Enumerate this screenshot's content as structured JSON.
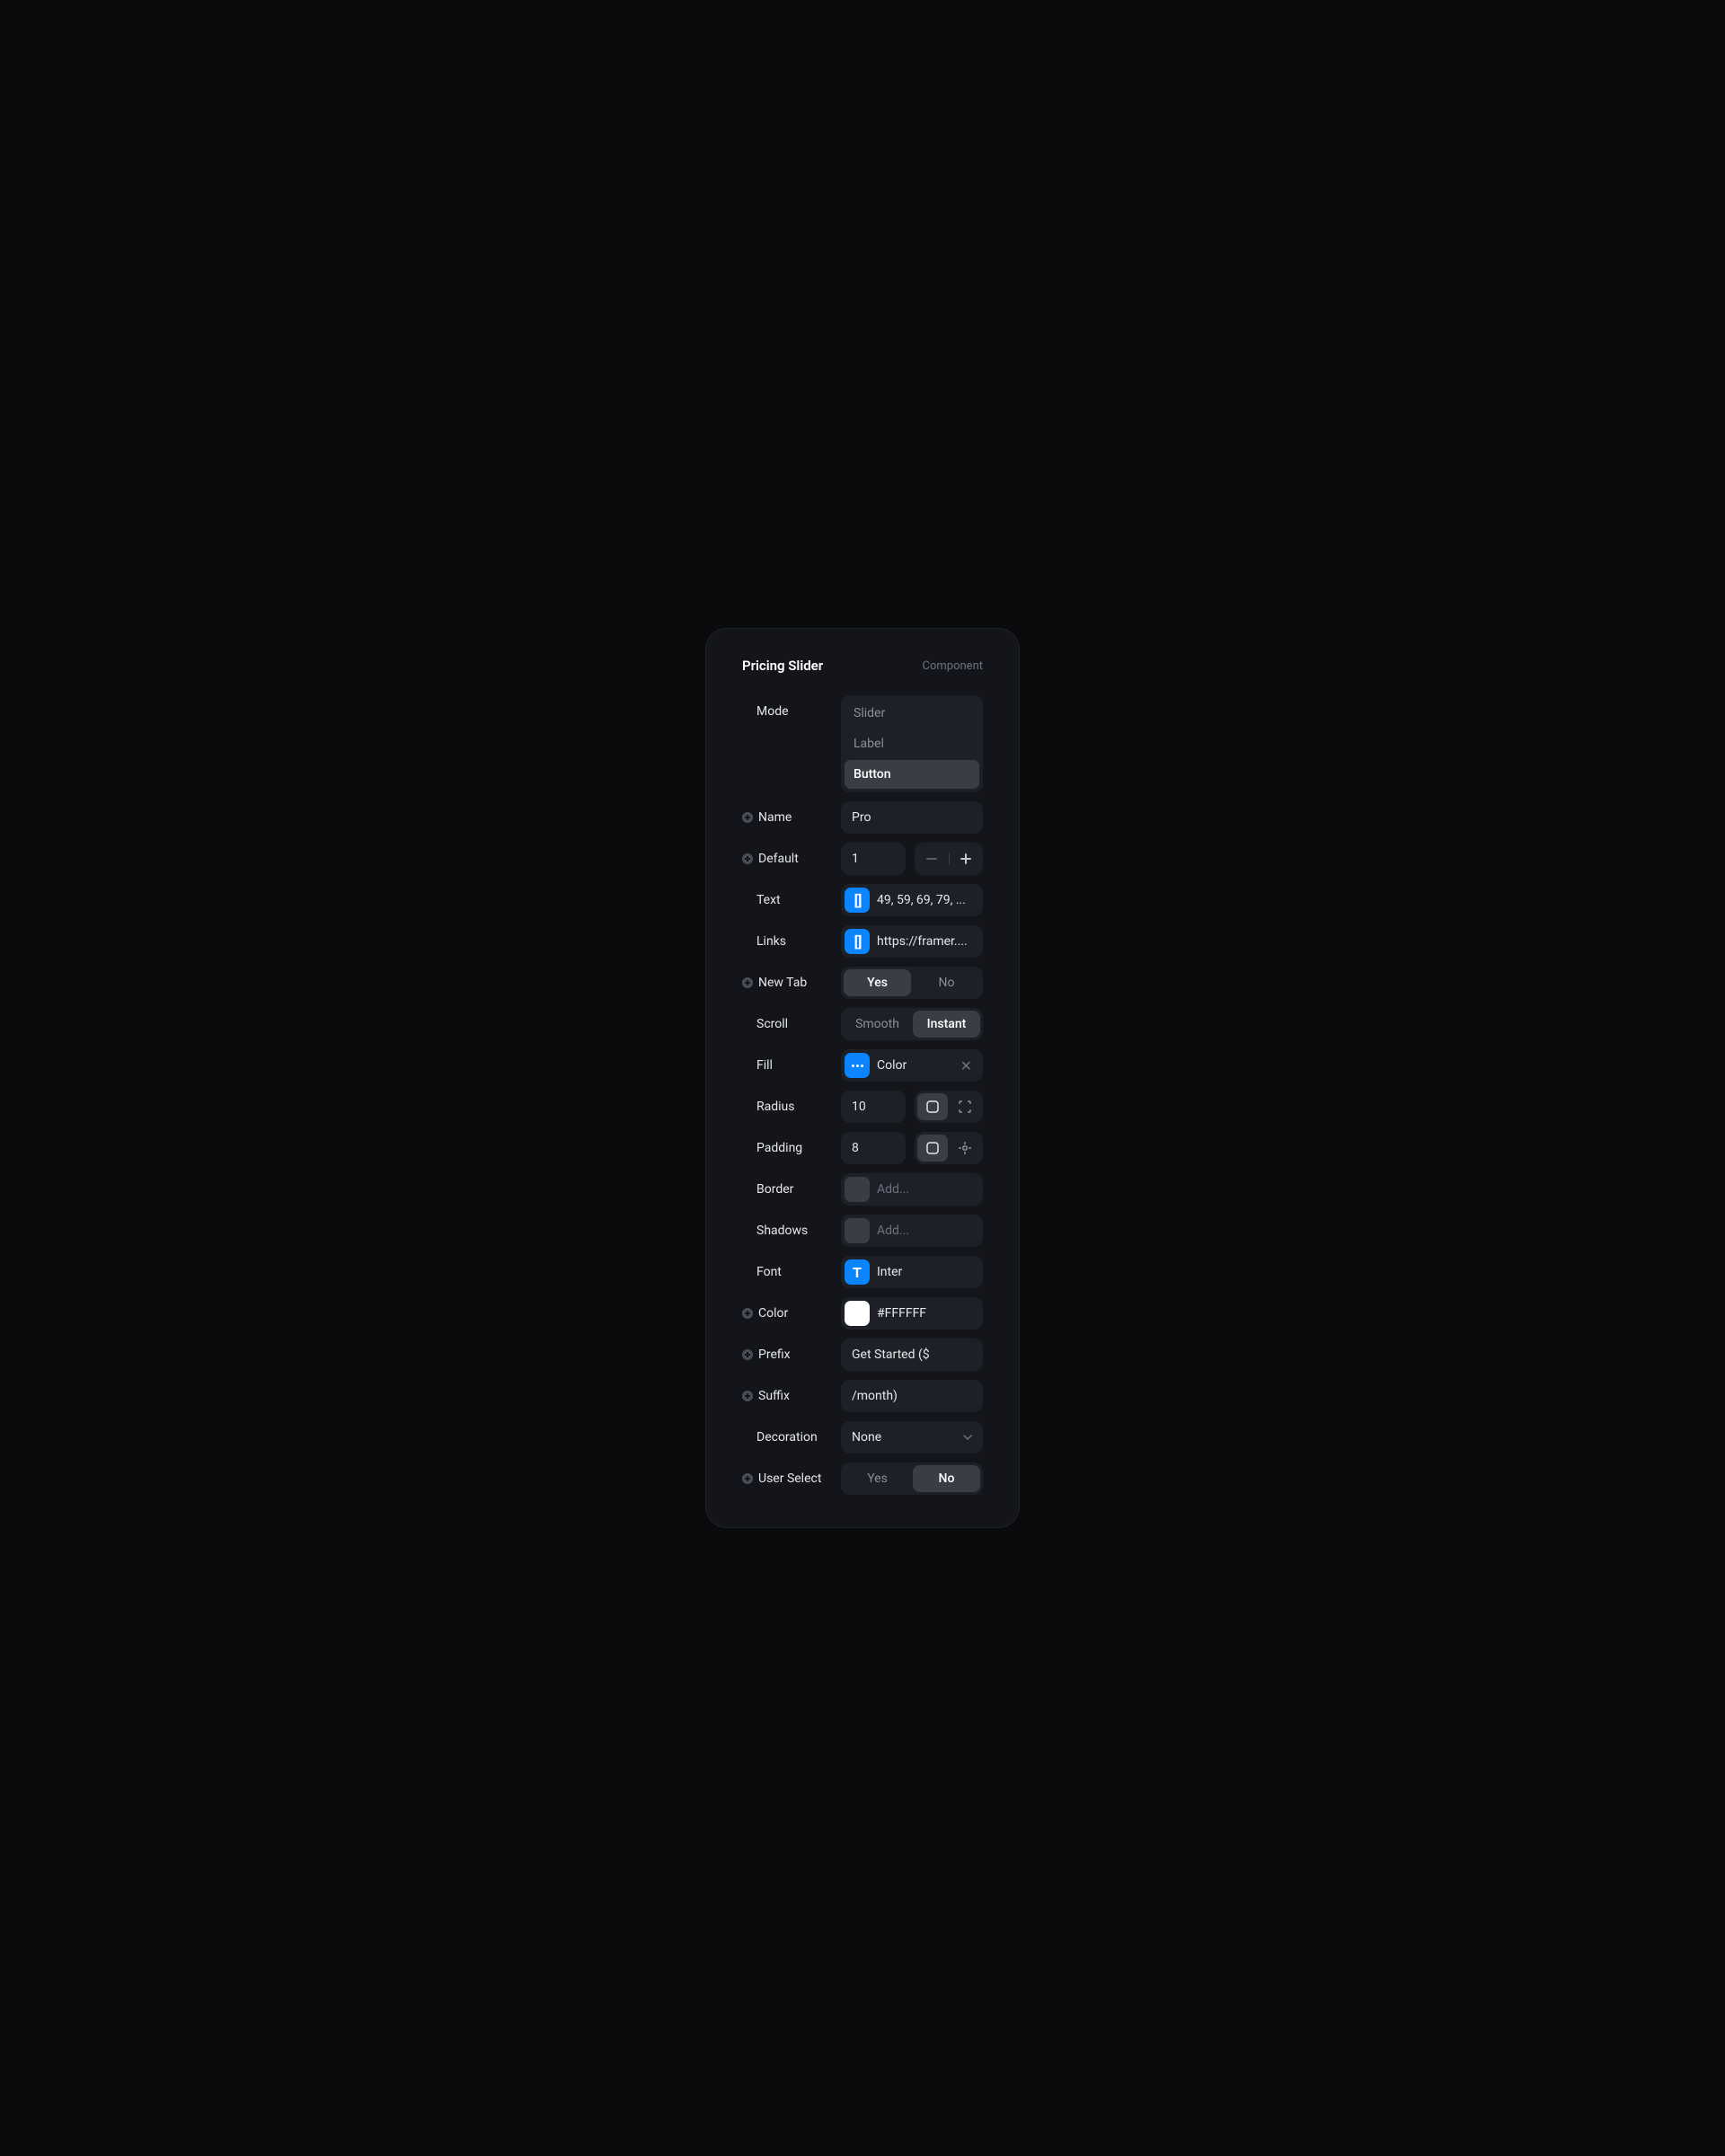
{
  "header": {
    "title": "Pricing Slider",
    "subtitle": "Component"
  },
  "mode": {
    "label": "Mode",
    "options": [
      "Slider",
      "Label",
      "Button"
    ],
    "selected": "Button"
  },
  "name": {
    "label": "Name",
    "value": "Pro"
  },
  "default": {
    "label": "Default",
    "value": "1"
  },
  "text": {
    "label": "Text",
    "value": "49, 59, 69, 79, ..."
  },
  "links": {
    "label": "Links",
    "value": "https://framer...."
  },
  "newTab": {
    "label": "New Tab",
    "options": [
      "Yes",
      "No"
    ],
    "selected": "Yes"
  },
  "scroll": {
    "label": "Scroll",
    "options": [
      "Smooth",
      "Instant"
    ],
    "selected": "Instant"
  },
  "fill": {
    "label": "Fill",
    "value": "Color"
  },
  "radius": {
    "label": "Radius",
    "value": "10"
  },
  "padding": {
    "label": "Padding",
    "value": "8"
  },
  "border": {
    "label": "Border",
    "placeholder": "Add..."
  },
  "shadows": {
    "label": "Shadows",
    "placeholder": "Add..."
  },
  "font": {
    "label": "Font",
    "value": "Inter"
  },
  "color": {
    "label": "Color",
    "value": "#FFFFFF"
  },
  "prefix": {
    "label": "Prefix",
    "value": "Get Started ($"
  },
  "suffix": {
    "label": "Suffix",
    "value": "/month)"
  },
  "decoration": {
    "label": "Decoration",
    "value": "None"
  },
  "userSelect": {
    "label": "User Select",
    "options": [
      "Yes",
      "No"
    ],
    "selected": "No"
  }
}
